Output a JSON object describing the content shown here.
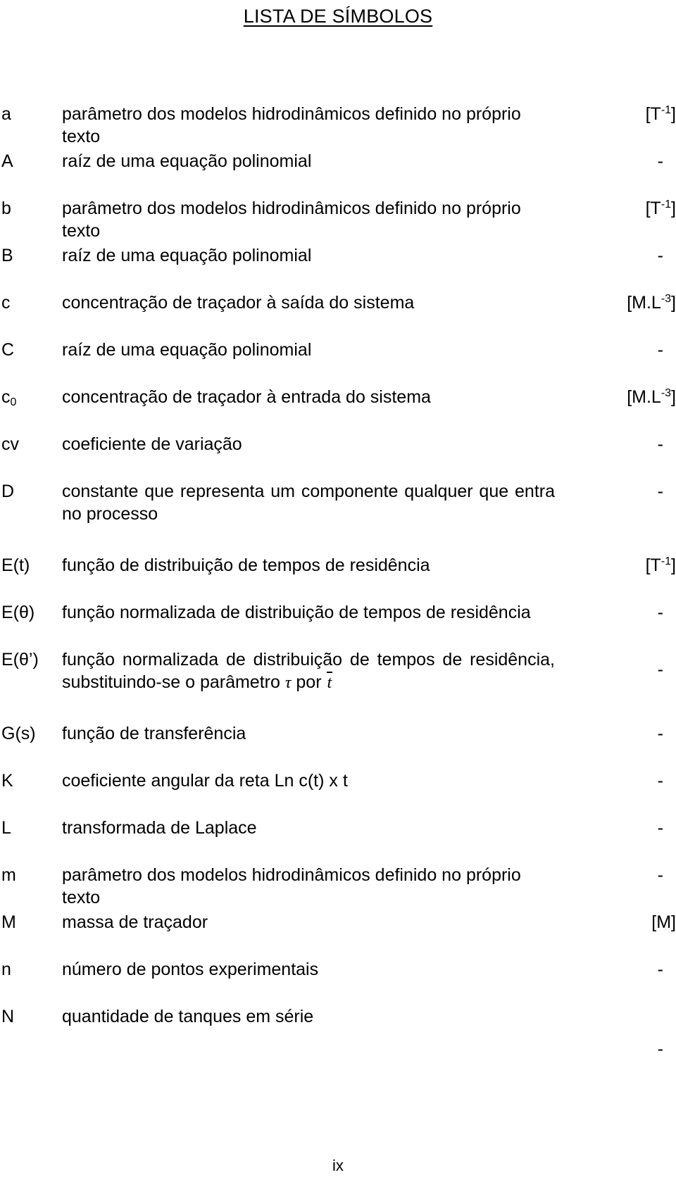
{
  "document": {
    "title": "LISTA DE SÍMBOLOS",
    "page_number": "ix"
  },
  "symbols": [
    {
      "key": "a",
      "key_sub": "",
      "description": "parâmetro dos modelos hidrodinâmicos definido no próprio texto",
      "unit_prefix": "[T",
      "unit_sup": "-1",
      "unit_suffix": "]",
      "unit_plain": ""
    },
    {
      "key": "A",
      "key_sub": "",
      "description": "raíz de uma equação polinomial",
      "unit_prefix": "",
      "unit_sup": "",
      "unit_suffix": "",
      "unit_plain": "-"
    },
    {
      "key": "b",
      "key_sub": "",
      "description": "parâmetro dos modelos hidrodinâmicos definido no próprio texto",
      "unit_prefix": "[T",
      "unit_sup": "-1",
      "unit_suffix": "]",
      "unit_plain": ""
    },
    {
      "key": "B",
      "key_sub": "",
      "description": "raíz de uma equação polinomial",
      "unit_prefix": "",
      "unit_sup": "",
      "unit_suffix": "",
      "unit_plain": "-"
    },
    {
      "key": "c",
      "key_sub": "",
      "description": "concentração de traçador à saída do sistema",
      "unit_prefix": "[M.L",
      "unit_sup": "-3",
      "unit_suffix": "]",
      "unit_plain": ""
    },
    {
      "key": "C",
      "key_sub": "",
      "description": "raíz de uma equação polinomial",
      "unit_prefix": "",
      "unit_sup": "",
      "unit_suffix": "",
      "unit_plain": "-"
    },
    {
      "key": "c",
      "key_sub": "0",
      "description": "concentração de traçador à entrada do sistema",
      "unit_prefix": "[M.L",
      "unit_sup": "-3",
      "unit_suffix": "]",
      "unit_plain": ""
    },
    {
      "key": "cv",
      "key_sub": "",
      "description": "coeficiente de variação",
      "unit_prefix": "",
      "unit_sup": "",
      "unit_suffix": "",
      "unit_plain": "-"
    },
    {
      "key": "D",
      "key_sub": "",
      "description": "constante que representa um componente qualquer que entra no processo",
      "unit_prefix": "",
      "unit_sup": "",
      "unit_suffix": "",
      "unit_plain": "-"
    },
    {
      "key": "E(t)",
      "key_sub": "",
      "description": "função de distribuição de tempos de residência",
      "unit_prefix": "[T",
      "unit_sup": "-1",
      "unit_suffix": "]",
      "unit_plain": ""
    },
    {
      "key": "E(θ)",
      "key_sub": "",
      "description": "função normalizada de distribuição de tempos de residência",
      "unit_prefix": "",
      "unit_sup": "",
      "unit_suffix": "",
      "unit_plain": "-"
    },
    {
      "key": "E(θ’)",
      "key_sub": "",
      "description_part1": "função normalizada de distribuição de tempos de residência, substituindo-se o parâmetro ",
      "description_math_tau": "τ",
      "description_part2": " por ",
      "description_math_tbar": "t",
      "unit_prefix": "",
      "unit_sup": "",
      "unit_suffix": "",
      "unit_plain": "-"
    },
    {
      "key": "G(s)",
      "key_sub": "",
      "description": "função de transferência",
      "unit_prefix": "",
      "unit_sup": "",
      "unit_suffix": "",
      "unit_plain": "-"
    },
    {
      "key": "K",
      "key_sub": "",
      "description": "coeficiente angular da reta Ln c(t) x t",
      "unit_prefix": "",
      "unit_sup": "",
      "unit_suffix": "",
      "unit_plain": "-"
    },
    {
      "key": "L",
      "key_sub": "",
      "description": "transformada de Laplace",
      "unit_prefix": "",
      "unit_sup": "",
      "unit_suffix": "",
      "unit_plain": "-"
    },
    {
      "key": "m",
      "key_sub": "",
      "description": "parâmetro dos modelos hidrodinâmicos definido no próprio texto",
      "unit_prefix": "",
      "unit_sup": "",
      "unit_suffix": "",
      "unit_plain": "-"
    },
    {
      "key": "M",
      "key_sub": "",
      "description": "massa de traçador",
      "unit_prefix": "",
      "unit_sup": "",
      "unit_suffix": "",
      "unit_plain": "[M]"
    },
    {
      "key": "n",
      "key_sub": "",
      "description": "número de pontos experimentais",
      "unit_prefix": "",
      "unit_sup": "",
      "unit_suffix": "",
      "unit_plain": "-"
    },
    {
      "key": "N",
      "key_sub": "",
      "description": "quantidade de tanques em série",
      "unit_prefix": "",
      "unit_sup": "",
      "unit_suffix": "",
      "unit_plain": "-"
    }
  ]
}
